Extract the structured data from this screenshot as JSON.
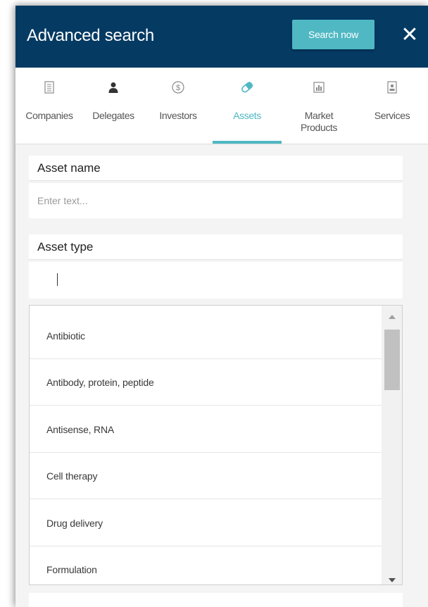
{
  "header": {
    "title": "Advanced search",
    "search_button": "Search now",
    "close_label": "✕"
  },
  "tabs": [
    {
      "label": "Companies",
      "icon": "building-icon",
      "active": false
    },
    {
      "label": "Delegates",
      "icon": "person-icon",
      "active": false
    },
    {
      "label": "Investors",
      "icon": "dollar-icon",
      "active": false
    },
    {
      "label": "Assets",
      "icon": "pill-icon",
      "active": true
    },
    {
      "label": "Market Products",
      "icon": "chart-icon",
      "active": false
    },
    {
      "label": "Services",
      "icon": "badge-icon",
      "active": false
    }
  ],
  "form": {
    "asset_name_label": "Asset name",
    "asset_name_placeholder": "Enter text...",
    "asset_name_value": "",
    "asset_type_label": "Asset type",
    "asset_type_value": ""
  },
  "dropdown": {
    "options": [
      "Antibiotic",
      "Antibody, protein, peptide",
      "Antisense, RNA",
      "Cell therapy",
      "Drug delivery",
      "Formulation"
    ]
  },
  "colors": {
    "header_bg": "#053a63",
    "accent": "#4fb8c3",
    "panel_bg": "#f4f4f4"
  }
}
